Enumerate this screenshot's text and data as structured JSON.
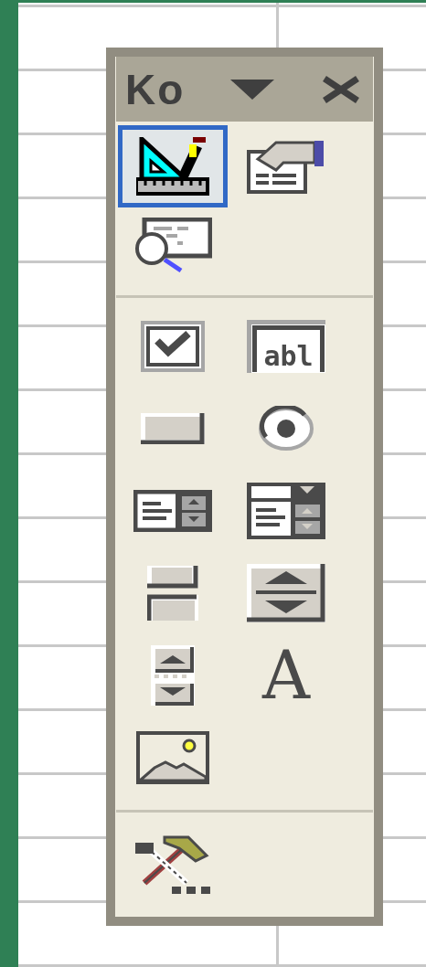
{
  "toolbar": {
    "title": "Ko",
    "groups": [
      [
        {
          "kind": "design_mode",
          "selected": true
        },
        {
          "kind": "properties",
          "selected": false
        },
        {
          "kind": "view_code",
          "selected": false
        }
      ],
      [
        {
          "kind": "checkbox",
          "selected": false
        },
        {
          "kind": "text_box",
          "glyph": "abl",
          "selected": false
        },
        {
          "kind": "command_button",
          "selected": false
        },
        {
          "kind": "option_button",
          "selected": false
        },
        {
          "kind": "list_box",
          "selected": false
        },
        {
          "kind": "combo_box",
          "selected": false
        },
        {
          "kind": "toggle_button",
          "selected": false
        },
        {
          "kind": "spin_button",
          "selected": false
        },
        {
          "kind": "scroll_bar",
          "selected": false
        },
        {
          "kind": "label",
          "glyph": "A",
          "selected": false
        },
        {
          "kind": "image",
          "selected": false
        }
      ],
      [
        {
          "kind": "more_controls",
          "selected": false
        }
      ]
    ]
  }
}
